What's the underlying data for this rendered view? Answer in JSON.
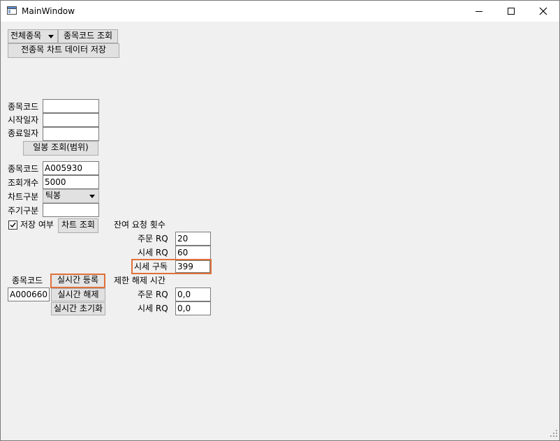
{
  "window": {
    "title": "MainWindow"
  },
  "top": {
    "market_combo": "전체종목",
    "code_query_button": "종목코드 조회",
    "save_all_button": "전종목 차트 데이터 저장"
  },
  "range": {
    "code_label": "종목코드",
    "start_label": "시작일자",
    "end_label": "종료일자",
    "code_value": "",
    "start_value": "",
    "end_value": "",
    "query_button": "일봉 조회(범위)"
  },
  "chart": {
    "code_label": "종목코드",
    "count_label": "조회개수",
    "type_label": "차트구분",
    "period_label": "주기구분",
    "code_value": "A005930",
    "count_value": "5000",
    "type_value": "틱봉",
    "period_value": "",
    "save_label": "저장 여부",
    "save_checked": true,
    "query_button": "차트 조회"
  },
  "remaining": {
    "header": "잔여 요청 횟수",
    "order_label": "주문 RQ",
    "order_value": "20",
    "quote_label": "시세 RQ",
    "quote_value": "60",
    "subscribe_label": "시세 구독",
    "subscribe_value": "399"
  },
  "realtime": {
    "code_label": "종목코드",
    "code_value": "A000660",
    "register_button": "실시간 등록",
    "unregister_button": "실시간 해제",
    "reset_button": "실시간 초기화"
  },
  "unlock": {
    "header": "제한 해제 시간",
    "order_label": "주문 RQ",
    "order_value": "0,0",
    "quote_label": "시세 RQ",
    "quote_value": "0,0"
  }
}
